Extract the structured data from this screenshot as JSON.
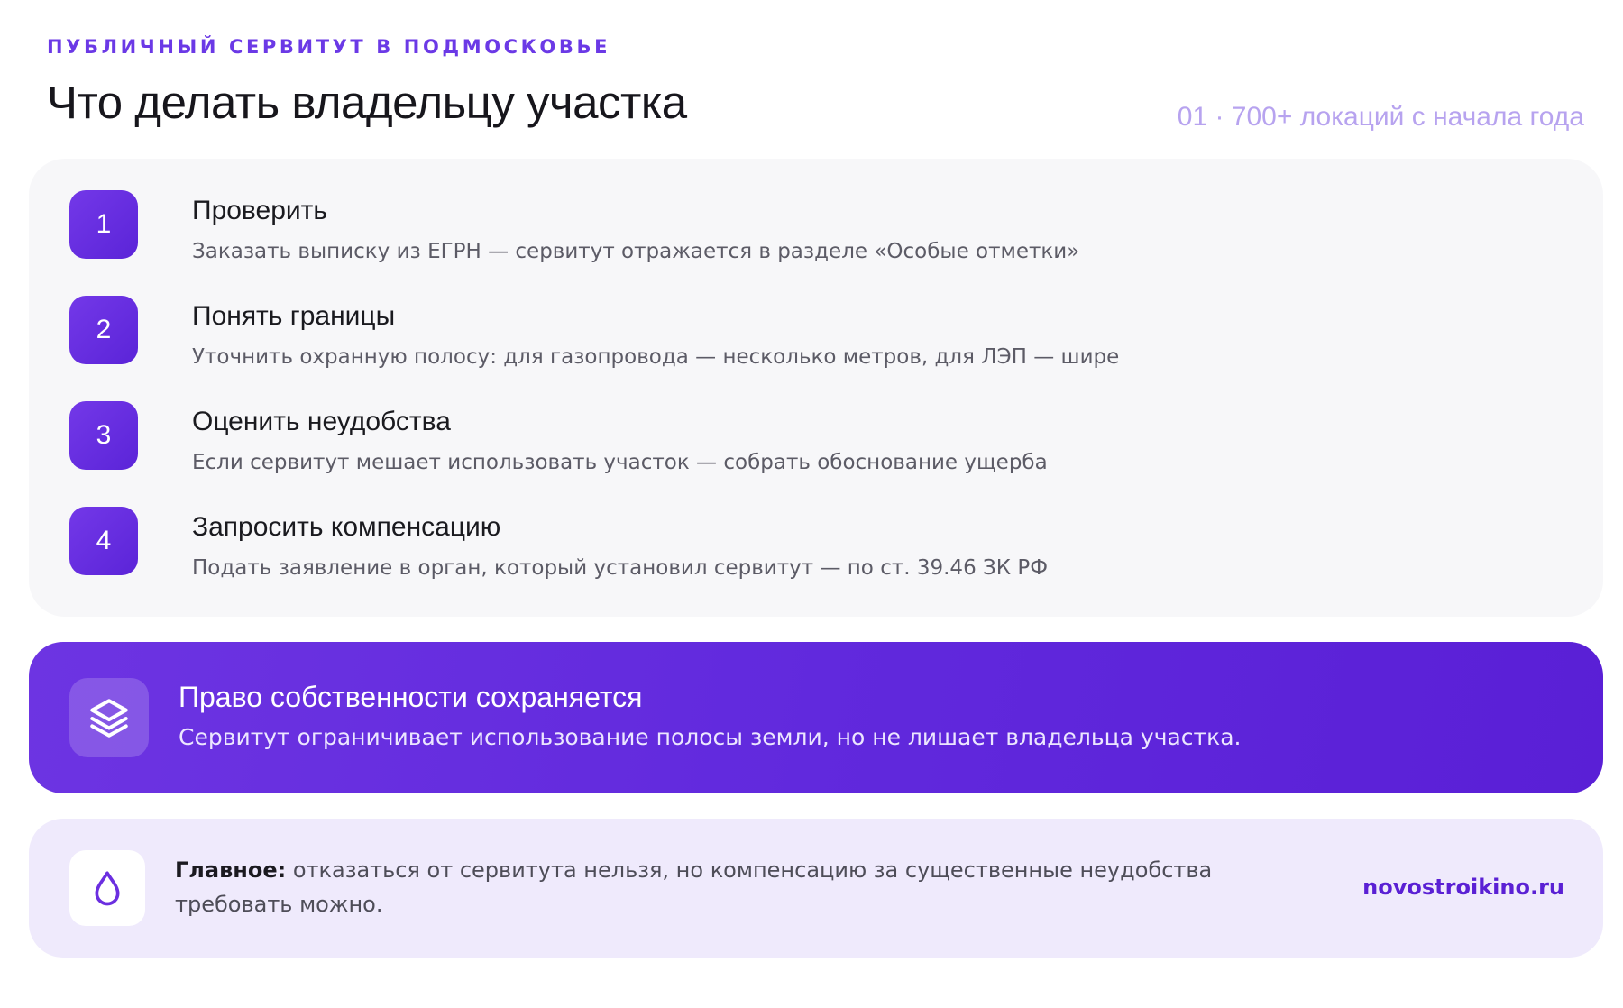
{
  "header": {
    "eyebrow": "ПУБЛИЧНЫЙ СЕРВИТУТ В ПОДМОСКОВЬЕ",
    "title": "Что делать владельцу участка",
    "meta": "01 · 700+ локаций с начала года"
  },
  "steps": [
    {
      "number": "1",
      "title": "Проверить",
      "description": "Заказать выписку из ЕГРН — сервитут отражается в разделе «Особые отметки»"
    },
    {
      "number": "2",
      "title": "Понять границы",
      "description": "Уточнить охранную полосу: для газопровода — несколько метров, для ЛЭП — шире"
    },
    {
      "number": "3",
      "title": "Оценить неудобства",
      "description": "Если сервитут мешает использовать участок — собрать обоснование ущерба"
    },
    {
      "number": "4",
      "title": "Запросить компенсацию",
      "description": "Подать заявление в орган, который установил сервитут — по ст. 39.46 ЗК РФ"
    }
  ],
  "banner": {
    "icon": "layers-icon",
    "title": "Право собственности сохраняется",
    "text": "Сервитут ограничивает использование полосы земли, но не лишает владельца участка."
  },
  "note": {
    "icon": "droplet-icon",
    "label": "Главное:",
    "text": " отказаться от сервитута нельзя, но компенсацию за существенные неудобства требовать можно."
  },
  "brand": "novostroikino.ru",
  "colors": {
    "accent": "#6b39e6",
    "banner": "#6129dd",
    "card": "#f7f7f9",
    "note_bg": "#efeafc",
    "meta": "#b7a3ef"
  }
}
